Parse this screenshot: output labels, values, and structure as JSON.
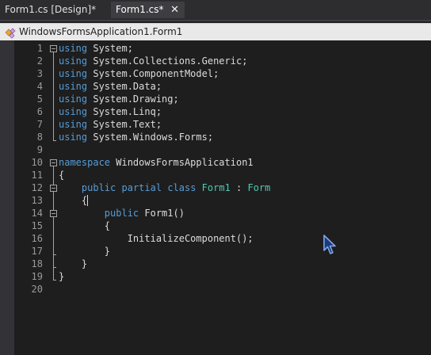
{
  "tabs": [
    {
      "label": "Form1.cs [Design]*",
      "active": false
    },
    {
      "label": "Form1.cs*",
      "active": true,
      "close_icon": "close-icon",
      "close_glyph": "✕"
    }
  ],
  "navigation": {
    "type_selector": "WindowsFormsApplication1.Form1",
    "type_icon": "class-icon"
  },
  "editor": {
    "line_numbers": [
      "1",
      "2",
      "3",
      "4",
      "5",
      "6",
      "7",
      "8",
      "9",
      "10",
      "11",
      "12",
      "13",
      "14",
      "15",
      "16",
      "17",
      "18",
      "19",
      "20"
    ],
    "lines": [
      [
        {
          "t": "using",
          "k": "kw"
        },
        {
          "t": " System;",
          "k": "tx"
        }
      ],
      [
        {
          "t": "using",
          "k": "kw"
        },
        {
          "t": " System.Collections.Generic;",
          "k": "tx"
        }
      ],
      [
        {
          "t": "using",
          "k": "kw"
        },
        {
          "t": " System.ComponentModel;",
          "k": "tx"
        }
      ],
      [
        {
          "t": "using",
          "k": "kw"
        },
        {
          "t": " System.Data;",
          "k": "tx"
        }
      ],
      [
        {
          "t": "using",
          "k": "kw"
        },
        {
          "t": " System.Drawing;",
          "k": "tx"
        }
      ],
      [
        {
          "t": "using",
          "k": "kw"
        },
        {
          "t": " System.Linq;",
          "k": "tx"
        }
      ],
      [
        {
          "t": "using",
          "k": "kw"
        },
        {
          "t": " System.Text;",
          "k": "tx"
        }
      ],
      [
        {
          "t": "using",
          "k": "kw"
        },
        {
          "t": " System.Windows.Forms;",
          "k": "tx"
        }
      ],
      [],
      [
        {
          "t": "namespace",
          "k": "kw"
        },
        {
          "t": " WindowsFormsApplication1",
          "k": "tx"
        }
      ],
      [
        {
          "t": "{",
          "k": "tx"
        }
      ],
      [
        {
          "t": "    ",
          "k": "tx"
        },
        {
          "t": "public",
          "k": "kw"
        },
        {
          "t": " ",
          "k": "tx"
        },
        {
          "t": "partial",
          "k": "kw"
        },
        {
          "t": " ",
          "k": "tx"
        },
        {
          "t": "class",
          "k": "kw"
        },
        {
          "t": " ",
          "k": "tx"
        },
        {
          "t": "Form1",
          "k": "ty"
        },
        {
          "t": " : ",
          "k": "tx"
        },
        {
          "t": "Form",
          "k": "ty"
        }
      ],
      [
        {
          "t": "    {",
          "k": "tx"
        }
      ],
      [
        {
          "t": "        ",
          "k": "tx"
        },
        {
          "t": "public",
          "k": "kw"
        },
        {
          "t": " Form1()",
          "k": "tx"
        }
      ],
      [
        {
          "t": "        {",
          "k": "tx"
        }
      ],
      [
        {
          "t": "            InitializeComponent();",
          "k": "tx"
        }
      ],
      [
        {
          "t": "        }",
          "k": "tx"
        }
      ],
      [
        {
          "t": "    }",
          "k": "tx"
        }
      ],
      [
        {
          "t": "}",
          "k": "tx"
        }
      ],
      []
    ],
    "fold_markers": [
      1,
      10,
      12,
      14
    ],
    "caret_line": 13,
    "mouse_cursor_icon": "mouse-pointer-icon"
  },
  "colors": {
    "keyword": "#569cd6",
    "type": "#4ec9b0",
    "text": "#dcdcdc",
    "background": "#1e1e1e",
    "line_number": "#9a9a9a"
  }
}
